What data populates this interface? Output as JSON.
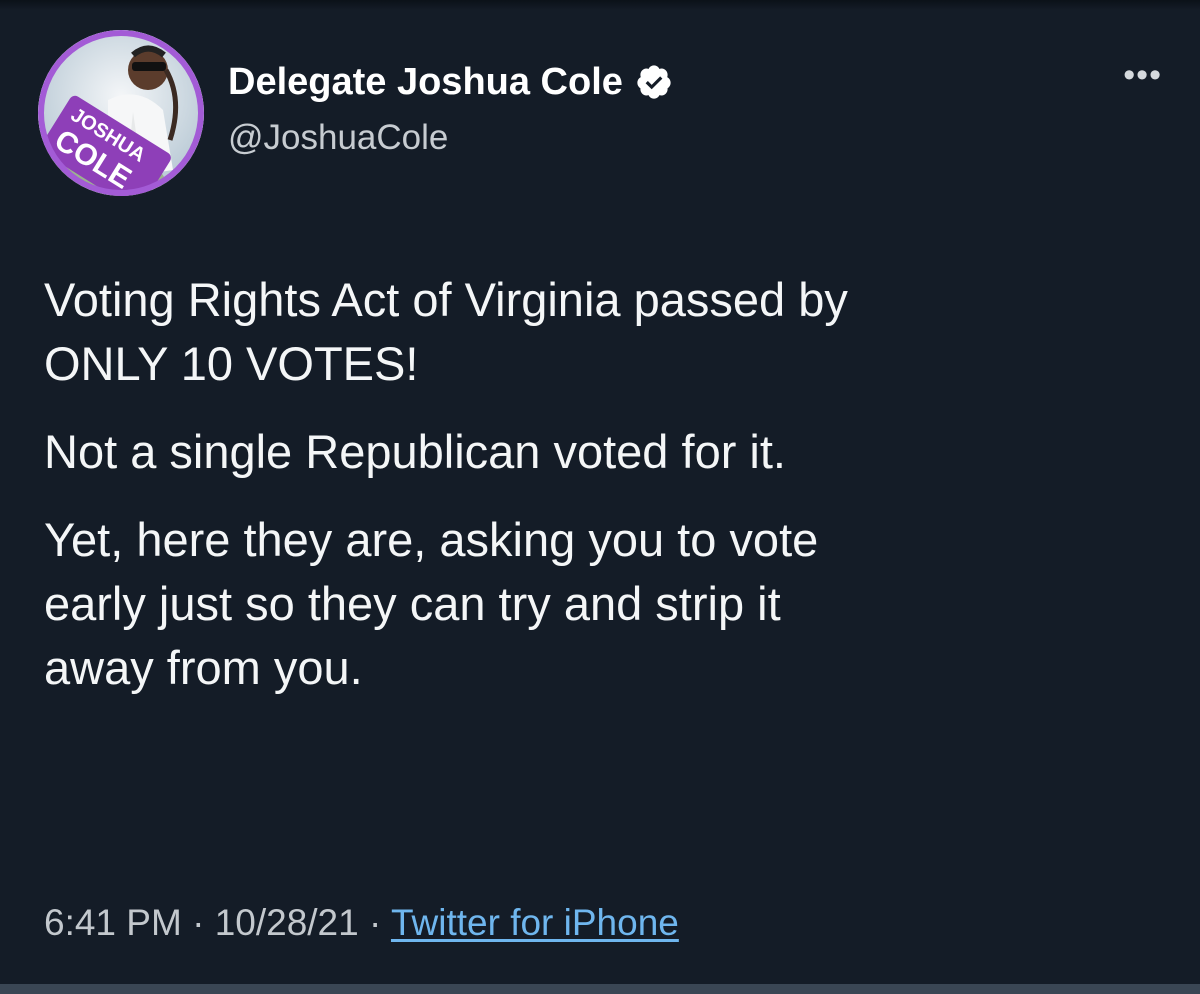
{
  "tweet": {
    "author_name": "Delegate Joshua Cole",
    "handle": "@JoshuaCole",
    "more_label": "•••",
    "verified": true,
    "paragraphs": [
      "Voting Rights Act of Virginia passed by\nONLY 10 VOTES!",
      "Not a single Republican voted for it.",
      "Yet, here they are, asking you to vote\nearly just so they can try and strip it\naway from you."
    ],
    "time": "6:41 PM",
    "separator": "·",
    "date": "10/28/21",
    "source": "Twitter for iPhone"
  },
  "avatar": {
    "sign_text_1": "JOSHUA",
    "sign_text_2": "COLE"
  },
  "colors": {
    "background": "#141c27",
    "link": "#6fb6ee",
    "avatar_ring": "#a35bd6",
    "sign": "#8e3fb8"
  },
  "icons": {
    "verified": "verified-badge-icon",
    "more": "more-options-icon"
  }
}
